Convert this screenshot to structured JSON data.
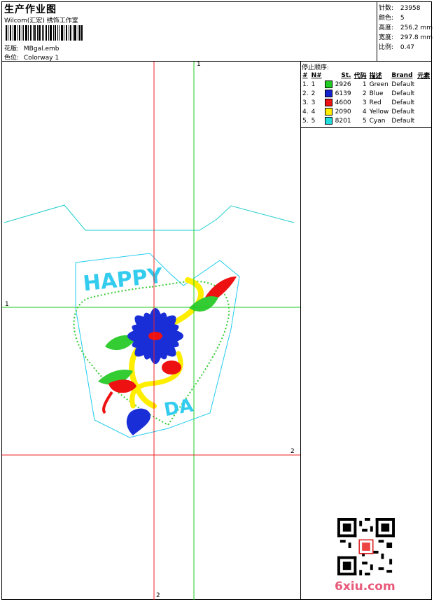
{
  "header": {
    "title": "生产作业图",
    "studio": "Wilcom(汇宏) 绣饰工作室",
    "design_label": "花版:",
    "design_value": "MBgal.emb",
    "colorway_label": "色位:",
    "colorway_value": "Colorway 1"
  },
  "stats": {
    "stitches_label": "针数:",
    "stitches_value": "23958",
    "colors_label": "颜色:",
    "colors_value": "5",
    "height_label": "高度:",
    "height_value": "256.2 mm",
    "width_label": "宽度:",
    "width_value": "297.8 mm",
    "scale_label": "比例:",
    "scale_value": "0.47"
  },
  "stop_sequence": {
    "title": "停止顺序:",
    "headers": [
      "#",
      "N#",
      "St.",
      "代码",
      "描述",
      "Brand",
      "元素"
    ],
    "rows": [
      {
        "num": "1.",
        "n": "1",
        "color": "#22cc22",
        "st": "2926",
        "code": "1",
        "desc": "Green",
        "brand": "Default"
      },
      {
        "num": "2.",
        "n": "2",
        "color": "#1122cc",
        "st": "6139",
        "code": "2",
        "desc": "Blue",
        "brand": "Default"
      },
      {
        "num": "3.",
        "n": "3",
        "color": "#ee1111",
        "st": "4600",
        "code": "3",
        "desc": "Red",
        "brand": "Default"
      },
      {
        "num": "4.",
        "n": "4",
        "color": "#ffee00",
        "st": "2090",
        "code": "4",
        "desc": "Yellow",
        "brand": "Default"
      },
      {
        "num": "5.",
        "n": "5",
        "color": "#22dddd",
        "st": "8201",
        "code": "5",
        "desc": "Cyan",
        "brand": "Default"
      }
    ]
  },
  "canvas": {
    "design_text_top": "HAPPY",
    "design_text_bottom": "DA",
    "axis_labels": {
      "green_top": "1",
      "green_left": "1",
      "red_right": "2",
      "red_bottom": "2"
    }
  },
  "watermark": "6xiu.com"
}
